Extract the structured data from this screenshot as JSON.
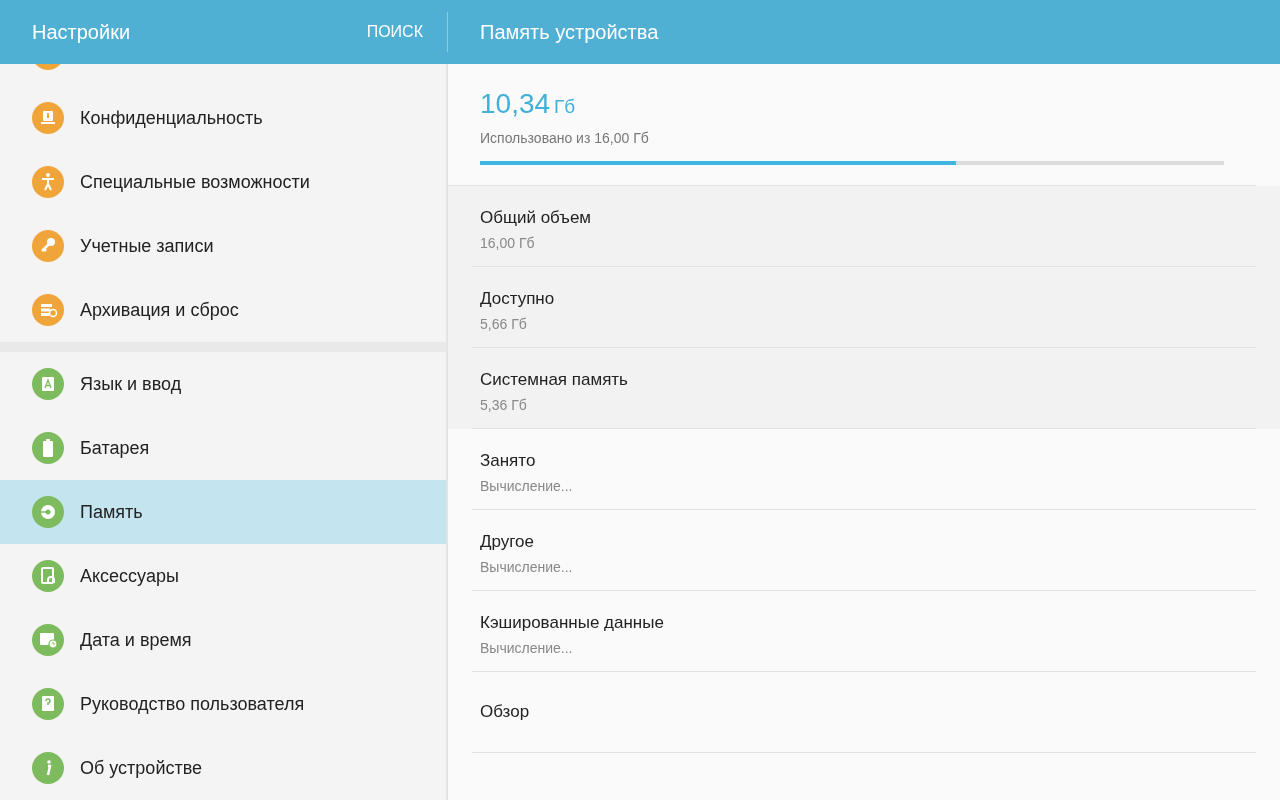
{
  "header": {
    "title": "Настройки",
    "search_button": "ПОИСК",
    "detail_title": "Память устройства"
  },
  "sidebar": {
    "groups": [
      {
        "items": [
          {
            "kind": "partial",
            "color": "#f0a53b"
          },
          {
            "kind": "item",
            "color": "#f0a53b",
            "label": "Конфиденциальность",
            "selected": false
          },
          {
            "kind": "item",
            "color": "#f0a53b",
            "label": "Специальные возможности",
            "selected": false
          },
          {
            "kind": "item",
            "color": "#f0a53b",
            "label": "Учетные записи",
            "selected": false
          },
          {
            "kind": "item",
            "color": "#f0a53b",
            "label": "Архивация и сброс",
            "selected": false
          }
        ]
      },
      {
        "items": [
          {
            "kind": "item",
            "color": "#7dbb5e",
            "label": "Язык и ввод",
            "selected": false
          },
          {
            "kind": "item",
            "color": "#7dbb5e",
            "label": "Батарея",
            "selected": false
          },
          {
            "kind": "item",
            "color": "#7dbb5e",
            "label": "Память",
            "selected": true
          },
          {
            "kind": "item",
            "color": "#7dbb5e",
            "label": "Аксессуары",
            "selected": false
          },
          {
            "kind": "item",
            "color": "#7dbb5e",
            "label": "Дата и время",
            "selected": false
          },
          {
            "kind": "item",
            "color": "#7dbb5e",
            "label": "Руководство пользователя",
            "selected": false
          },
          {
            "kind": "item",
            "color": "#7dbb5e",
            "label": "Об устройстве",
            "selected": false
          }
        ]
      }
    ]
  },
  "storage": {
    "used": "10,34",
    "unit": "Гб",
    "caption": "Использовано из 16,00 Гб",
    "level": 0.64
  },
  "rows": [
    {
      "kind": "static",
      "title": "Общий объем",
      "value": "16,00 Гб"
    },
    {
      "kind": "static",
      "title": "Доступно",
      "value": "5,66 Гб"
    },
    {
      "kind": "static",
      "title": "Системная память",
      "value": "5,36 Гб"
    },
    {
      "kind": "link",
      "title": "Занято",
      "value": "Вычисление..."
    },
    {
      "kind": "link",
      "title": "Другое",
      "value": "Вычисление..."
    },
    {
      "kind": "link",
      "title": "Кэшированные данные",
      "value": "Вычисление..."
    },
    {
      "kind": "link",
      "title": "Обзор"
    }
  ]
}
